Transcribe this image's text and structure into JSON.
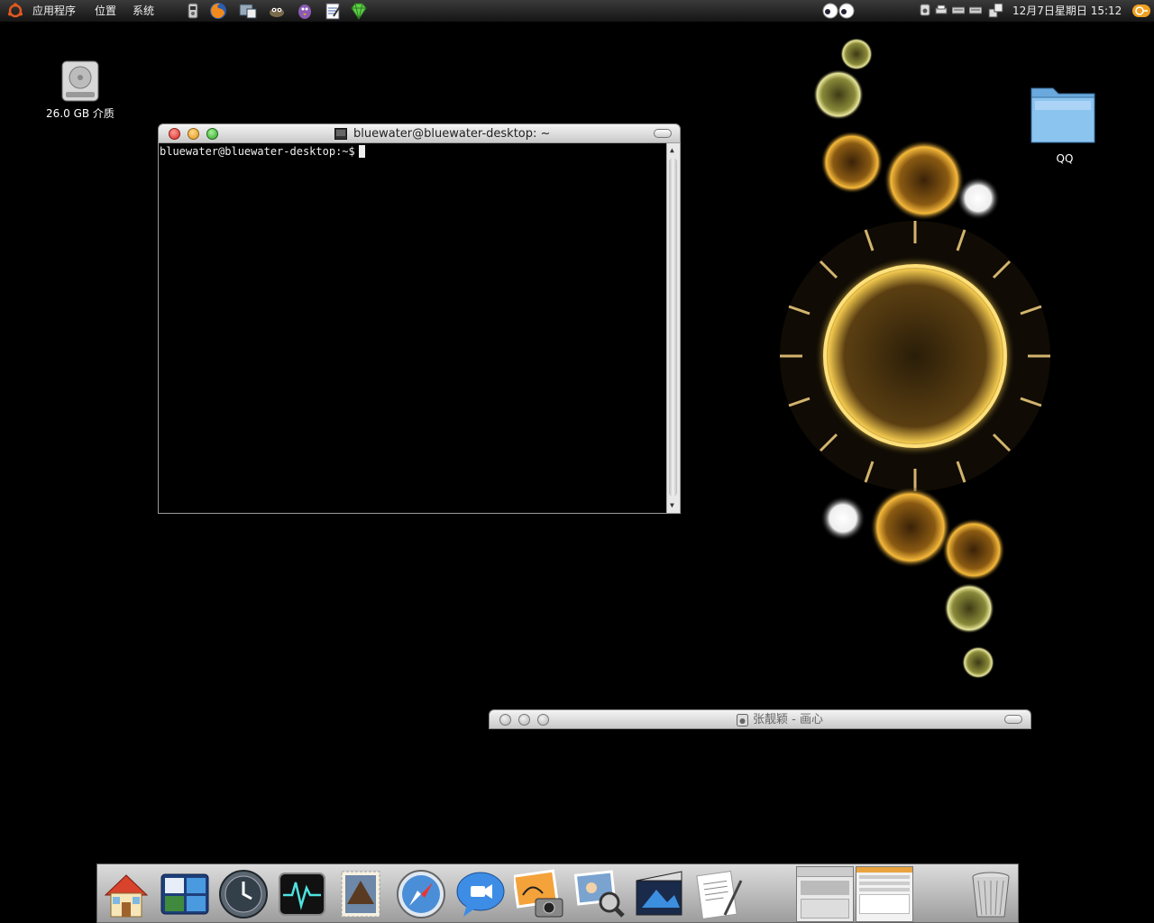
{
  "top_panel": {
    "menus": [
      "应用程序",
      "位置",
      "系统"
    ],
    "launchers": [
      "system-monitor-icon",
      "firefox-icon",
      "screenshot-icon",
      "gimp-icon",
      "pidgin-icon",
      "text-editor-icon",
      "gem-icon"
    ],
    "tray": [
      "eyes-applet-icon",
      "volume-icon",
      "printer-icon",
      "keyboard-icon",
      "battery-icon",
      "network-icon"
    ],
    "clock": "12月7日星期日 15:12"
  },
  "desktop": {
    "drive_label": "26.0 GB 介质",
    "folder_label": "QQ"
  },
  "terminal": {
    "title": "bluewater@bluewater-desktop: ~",
    "prompt": "bluewater@bluewater-desktop:~$"
  },
  "music_window": {
    "title": "张靓颖  - 画心"
  },
  "dock": {
    "items": [
      "home-icon",
      "spaces-icon",
      "time-machine-icon",
      "activity-monitor-icon",
      "mail-stamp-icon",
      "safari-icon",
      "ichat-icon",
      "iphoto-icon",
      "preview-icon",
      "imovie-icon",
      "textedit-icon",
      "window-thumbnail-1",
      "window-thumbnail-2",
      "trash-icon"
    ]
  },
  "colors": {
    "desktop_bg": "#000000",
    "panel_bg": "#2a2a2a",
    "close": "#e0443e",
    "minimize": "#dea123",
    "zoom": "#1aab29"
  }
}
